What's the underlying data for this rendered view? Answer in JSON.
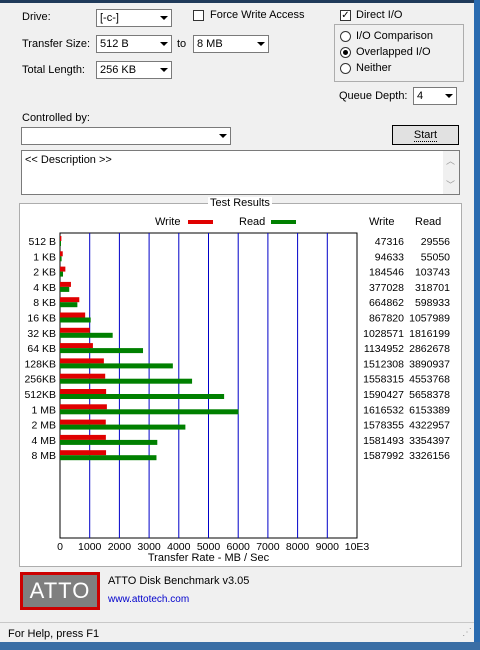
{
  "window": {
    "background": "#f0f0f0"
  },
  "controls": {
    "drive_label": "Drive:",
    "drive_value": "[-c-]",
    "force_write_label": "Force Write Access",
    "force_write_checked": false,
    "direct_io_label": "Direct I/O",
    "direct_io_checked": true,
    "transfer_size_label": "Transfer Size:",
    "transfer_from": "512 B",
    "to_label": "to",
    "transfer_to": "8 MB",
    "total_length_label": "Total Length:",
    "total_length_value": "256 KB",
    "io_options": [
      {
        "label": "I/O Comparison",
        "selected": false
      },
      {
        "label": "Overlapped I/O",
        "selected": true
      },
      {
        "label": "Neither",
        "selected": false
      }
    ],
    "queue_depth_label": "Queue Depth:",
    "queue_depth_value": "4",
    "controlled_by_label": "Controlled by:",
    "controlled_by_value": "",
    "start_button": "Start",
    "description_text": "<< Description >>"
  },
  "results": {
    "group_title": "Test Results",
    "legend_write": "Write",
    "legend_read": "Read",
    "col_write": "Write",
    "col_read": "Read",
    "write_color": "#e00000",
    "read_color": "#008000",
    "rows": [
      {
        "size": "512 B",
        "write": "47316",
        "read": "29556"
      },
      {
        "size": "1 KB",
        "write": "94633",
        "read": "55050"
      },
      {
        "size": "2 KB",
        "write": "184546",
        "read": "103743"
      },
      {
        "size": "4 KB",
        "write": "377028",
        "read": "318701"
      },
      {
        "size": "8 KB",
        "write": "664862",
        "read": "598933"
      },
      {
        "size": "16 KB",
        "write": "867820",
        "read": "1057989"
      },
      {
        "size": "32 KB",
        "write": "1028571",
        "read": "1816199"
      },
      {
        "size": "64 KB",
        "write": "1134952",
        "read": "2862678"
      },
      {
        "size": "128KB",
        "write": "1512308",
        "read": "3890937"
      },
      {
        "size": "256KB",
        "write": "1558315",
        "read": "4553768"
      },
      {
        "size": "512KB",
        "write": "1590427",
        "read": "5658378"
      },
      {
        "size": "1 MB",
        "write": "1616532",
        "read": "6153389"
      },
      {
        "size": "2 MB",
        "write": "1578355",
        "read": "4322957"
      },
      {
        "size": "4 MB",
        "write": "1581493",
        "read": "3354397"
      },
      {
        "size": "8 MB",
        "write": "1587992",
        "read": "3326156"
      }
    ]
  },
  "chart_data": {
    "type": "bar",
    "orientation": "horizontal",
    "categories": [
      "512 B",
      "1 KB",
      "2 KB",
      "4 KB",
      "8 KB",
      "16 KB",
      "32 KB",
      "64 KB",
      "128KB",
      "256KB",
      "512KB",
      "1 MB",
      "2 MB",
      "4 MB",
      "8 MB"
    ],
    "series": [
      {
        "name": "Write",
        "values": [
          47316,
          94633,
          184546,
          377028,
          664862,
          867820,
          1028571,
          1134952,
          1512308,
          1558315,
          1590427,
          1616532,
          1578355,
          1581493,
          1587992
        ]
      },
      {
        "name": "Read",
        "values": [
          29556,
          55050,
          103743,
          318701,
          598933,
          1057989,
          1816199,
          2862678,
          3890937,
          4553768,
          5658378,
          6153389,
          4322957,
          3354397,
          3326156
        ]
      }
    ],
    "x_ticks": [
      "0",
      "1000",
      "2000",
      "3000",
      "4000",
      "5000",
      "6000",
      "7000",
      "8000",
      "9000",
      "10E3"
    ],
    "xlabel": "Transfer Rate - MB / Sec",
    "xlim": [
      0,
      10000
    ],
    "grid": true,
    "legend_position": "top"
  },
  "branding": {
    "logo_text": "ATTO",
    "product": "ATTO Disk Benchmark v3.05",
    "url": "www.attotech.com"
  },
  "status_bar": {
    "text": "For Help, press F1"
  }
}
